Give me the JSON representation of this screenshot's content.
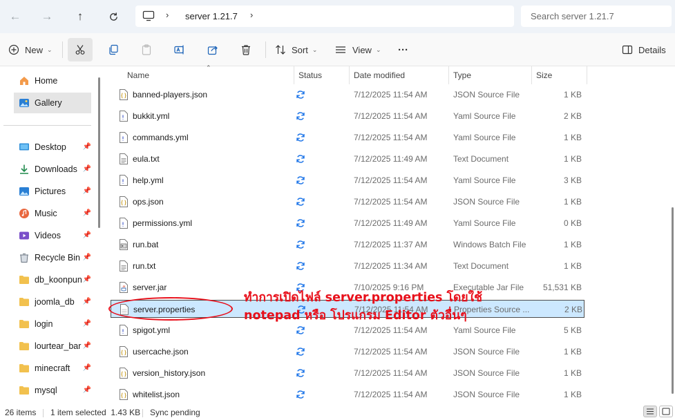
{
  "address": {
    "breadcrumb": "server 1.21.7",
    "search_placeholder": "Search server 1.21.7"
  },
  "toolbar": {
    "new_label": "New",
    "sort_label": "Sort",
    "view_label": "View",
    "more_label": "···",
    "details_label": "Details"
  },
  "sidebar": {
    "top": [
      {
        "label": "Home",
        "icon": "home-icon"
      },
      {
        "label": "Gallery",
        "icon": "gallery-icon"
      }
    ],
    "quick": [
      {
        "label": "Desktop",
        "icon": "desktop-icon"
      },
      {
        "label": "Downloads",
        "icon": "downloads-icon"
      },
      {
        "label": "Pictures",
        "icon": "pictures-icon"
      },
      {
        "label": "Music",
        "icon": "music-icon"
      },
      {
        "label": "Videos",
        "icon": "videos-icon"
      },
      {
        "label": "Recycle Bin",
        "icon": "recycle-bin-icon"
      },
      {
        "label": "db_koonpun",
        "icon": "folder-icon"
      },
      {
        "label": "joomla_db",
        "icon": "folder-icon"
      },
      {
        "label": "login",
        "icon": "folder-icon"
      },
      {
        "label": "lourtear_barb",
        "icon": "folder-icon"
      },
      {
        "label": "minecraft",
        "icon": "folder-icon"
      },
      {
        "label": "mysql",
        "icon": "folder-icon"
      }
    ]
  },
  "columns": {
    "name": "Name",
    "status": "Status",
    "date": "Date modified",
    "type": "Type",
    "size": "Size"
  },
  "files": [
    {
      "name": "banned-players.json",
      "date": "7/12/2025 11:54 AM",
      "type": "JSON Source File",
      "size": "1 KB",
      "icon": "json-file-icon"
    },
    {
      "name": "bukkit.yml",
      "date": "7/12/2025 11:54 AM",
      "type": "Yaml Source File",
      "size": "2 KB",
      "icon": "yaml-file-icon"
    },
    {
      "name": "commands.yml",
      "date": "7/12/2025 11:54 AM",
      "type": "Yaml Source File",
      "size": "1 KB",
      "icon": "yaml-file-icon"
    },
    {
      "name": "eula.txt",
      "date": "7/12/2025 11:49 AM",
      "type": "Text Document",
      "size": "1 KB",
      "icon": "text-file-icon"
    },
    {
      "name": "help.yml",
      "date": "7/12/2025 11:54 AM",
      "type": "Yaml Source File",
      "size": "3 KB",
      "icon": "yaml-file-icon"
    },
    {
      "name": "ops.json",
      "date": "7/12/2025 11:54 AM",
      "type": "JSON Source File",
      "size": "1 KB",
      "icon": "json-file-icon"
    },
    {
      "name": "permissions.yml",
      "date": "7/12/2025 11:49 AM",
      "type": "Yaml Source File",
      "size": "0 KB",
      "icon": "yaml-file-icon"
    },
    {
      "name": "run.bat",
      "date": "7/12/2025 11:37 AM",
      "type": "Windows Batch File",
      "size": "1 KB",
      "icon": "batch-file-icon"
    },
    {
      "name": "run.txt",
      "date": "7/12/2025 11:34 AM",
      "type": "Text Document",
      "size": "1 KB",
      "icon": "text-file-icon"
    },
    {
      "name": "server.jar",
      "date": "7/10/2025 9:16 PM",
      "type": "Executable Jar File",
      "size": "51,531 KB",
      "icon": "jar-file-icon"
    },
    {
      "name": "server.properties",
      "date": "7/12/2025 11:54 AM",
      "type": "Properties Source ...",
      "size": "2 KB",
      "icon": "properties-file-icon",
      "selected": true
    },
    {
      "name": "spigot.yml",
      "date": "7/12/2025 11:54 AM",
      "type": "Yaml Source File",
      "size": "5 KB",
      "icon": "yaml-file-icon"
    },
    {
      "name": "usercache.json",
      "date": "7/12/2025 11:54 AM",
      "type": "JSON Source File",
      "size": "1 KB",
      "icon": "json-file-icon"
    },
    {
      "name": "version_history.json",
      "date": "7/12/2025 11:54 AM",
      "type": "JSON Source File",
      "size": "1 KB",
      "icon": "json-file-icon"
    },
    {
      "name": "whitelist.json",
      "date": "7/12/2025 11:54 AM",
      "type": "JSON Source File",
      "size": "1 KB",
      "icon": "json-file-icon"
    }
  ],
  "annotation": {
    "line1": "ทำการเปิดไฟล์ server.properties โดยใช้",
    "line2": "notepad หรือ โปรแกรม Editor ตัวอื่นๆ",
    "color": "#e8101b"
  },
  "statusbar": {
    "items_count": "26 items",
    "selection": "1 item selected  1.43 KB",
    "sync": "Sync pending"
  },
  "colors": {
    "selection_bg": "#cce8ff",
    "sync_icon": "#1a73e8",
    "folder": "#f2c14e"
  }
}
